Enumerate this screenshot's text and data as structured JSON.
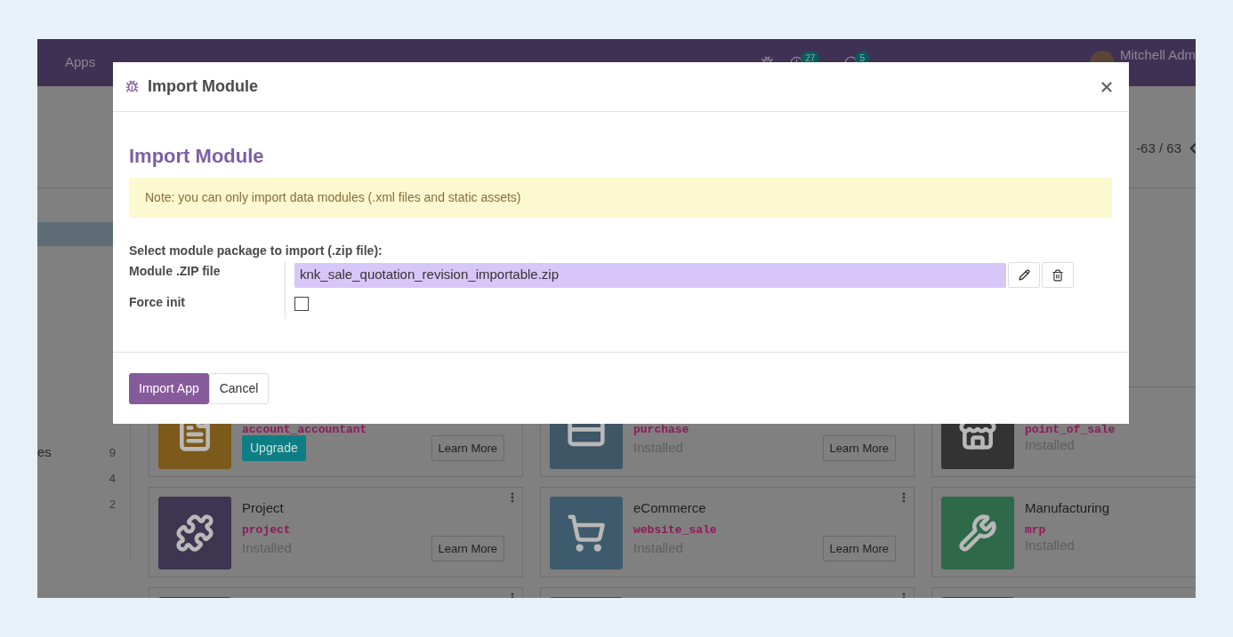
{
  "navbar": {
    "menu": [
      "Apps"
    ],
    "activity_badge": "27",
    "messages_badge": "5",
    "user": "Mitchell Adm"
  },
  "pager": "-63 / 63",
  "sidebar": {
    "items": [
      {
        "label": "es",
        "count": "9"
      },
      {
        "count": "4"
      },
      {
        "count": "2"
      }
    ]
  },
  "cards": [
    {
      "color": "#7c5a1c",
      "tech_name": "account_accountant",
      "status": {
        "kind": "button",
        "text": "Upgrade"
      },
      "learn_more": "Learn More"
    },
    {
      "color": "#3e5666",
      "tech_name": "purchase",
      "status": {
        "kind": "text",
        "text": "Installed"
      },
      "learn_more": "Learn More"
    },
    {
      "color": "#333333",
      "tech_name": "point_of_sale",
      "status": {
        "kind": "text",
        "text": "Installed"
      }
    },
    {
      "color": "#3e3550",
      "menu": true,
      "name": "Project",
      "tech_name": "project",
      "status": {
        "kind": "text",
        "text": "Installed"
      },
      "learn_more": "Learn More"
    },
    {
      "color": "#3d5b6c",
      "menu": true,
      "name": "eCommerce",
      "tech_name": "website_sale",
      "status": {
        "kind": "text",
        "text": "Installed"
      },
      "learn_more": "Learn More"
    },
    {
      "color": "#2e6a4a",
      "name": "Manufacturing",
      "tech_name": "mrp",
      "status": {
        "kind": "text",
        "text": "Installed"
      }
    },
    {
      "color": "#3a3a3a",
      "menu": true
    },
    {
      "color": "#8c1b54",
      "menu": true
    },
    {
      "color": "#3a3a3a"
    }
  ],
  "dialog": {
    "title": "Import Module",
    "heading": "Import Module",
    "note": "Note: you can only import data modules (.xml files and static assets)",
    "section_label": "Select module package to import (.zip file):",
    "file_field": {
      "label": "Module .ZIP file",
      "value": "knk_sale_quotation_revision_importable.zip"
    },
    "force_init": {
      "label": "Force init",
      "checked": false
    },
    "buttons": [
      {
        "kind": "primary",
        "label": "Import App"
      },
      {
        "kind": "secondary",
        "label": "Cancel"
      }
    ]
  }
}
